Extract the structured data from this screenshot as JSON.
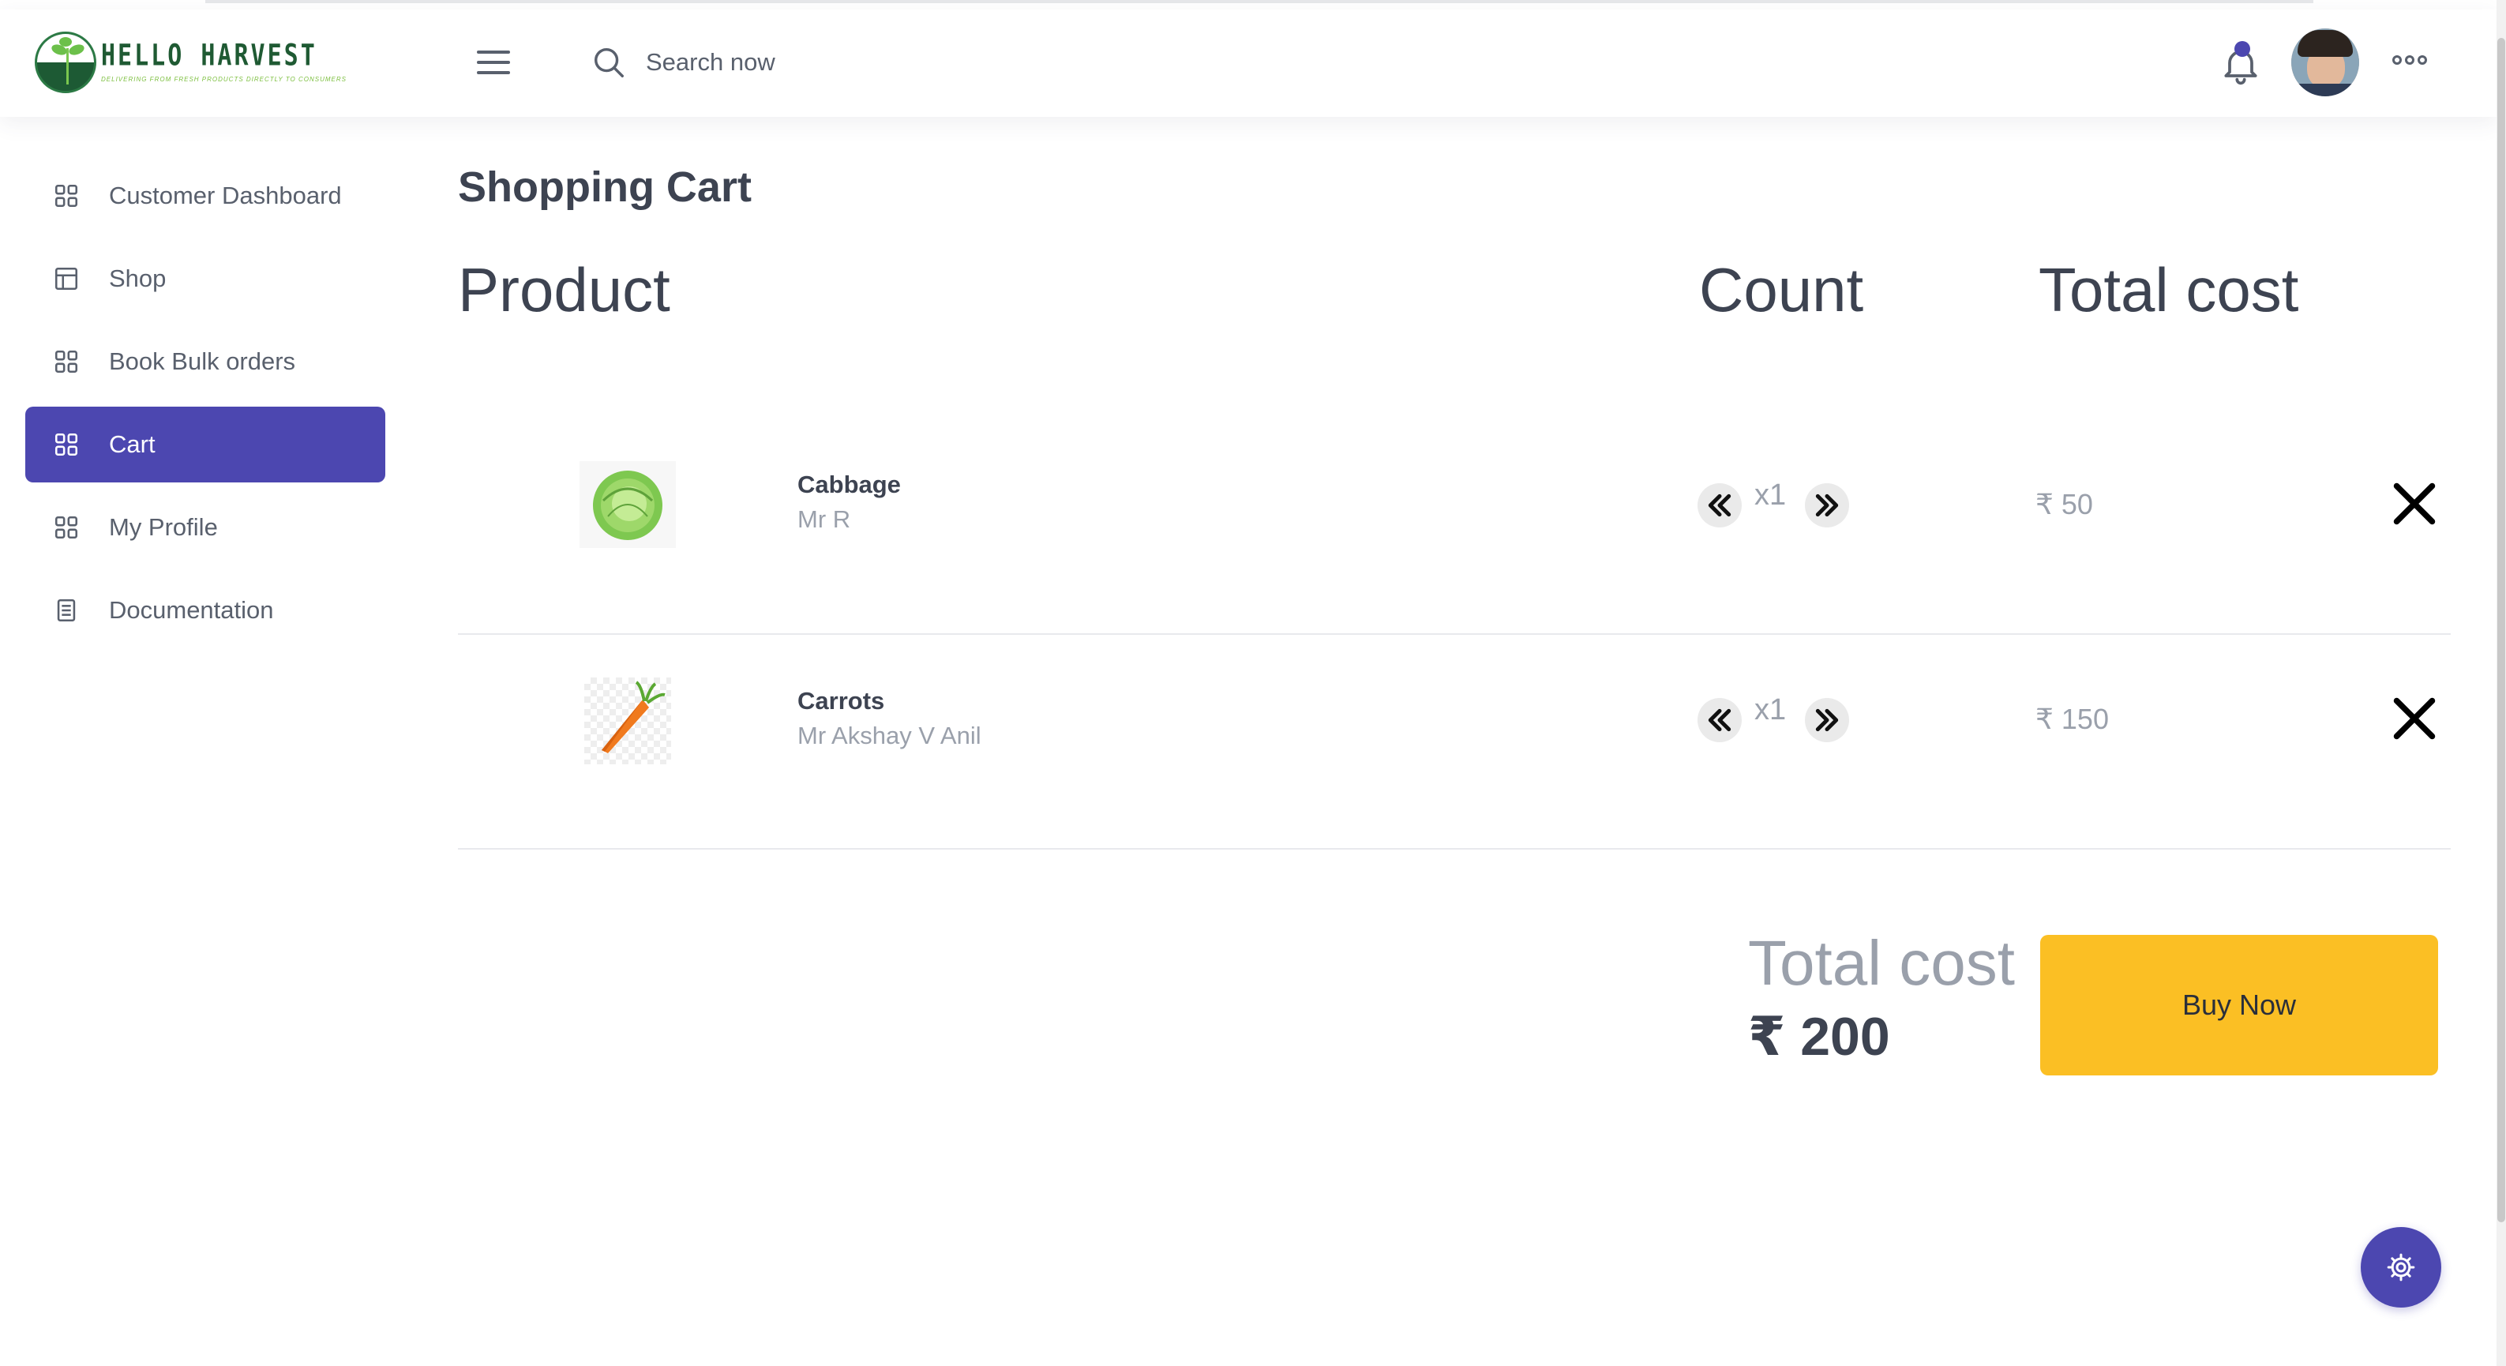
{
  "brand": {
    "name": "HELLO HARVEST",
    "tagline": "DELIVERING FROM FRESH PRODUCTS DIRECTLY TO CONSUMERS",
    "color": "#1f5a33"
  },
  "header": {
    "search_placeholder": "Search now",
    "icons": [
      "menu-icon",
      "search-icon",
      "bell-icon",
      "avatar",
      "more-icon"
    ]
  },
  "sidebar": {
    "items": [
      {
        "label": "Customer Dashboard",
        "icon": "grid-icon",
        "active": false
      },
      {
        "label": "Shop",
        "icon": "layout-icon",
        "active": false
      },
      {
        "label": "Book Bulk orders",
        "icon": "grid-icon",
        "active": false
      },
      {
        "label": "Cart",
        "icon": "grid-icon",
        "active": true
      },
      {
        "label": "My Profile",
        "icon": "grid-icon",
        "active": false
      },
      {
        "label": "Documentation",
        "icon": "document-icon",
        "active": false
      }
    ]
  },
  "cart": {
    "title": "Shopping Cart",
    "columns": {
      "product": "Product",
      "count": "Count",
      "total": "Total cost"
    },
    "items": [
      {
        "name": "Cabbage",
        "seller": "Mr R",
        "qty": "x1",
        "price": "₹ 50",
        "image": "cabbage"
      },
      {
        "name": "Carrots",
        "seller": "Mr Akshay V Anil",
        "qty": "x1",
        "price": "₹ 150",
        "image": "carrot"
      }
    ],
    "total_label": "Total cost",
    "total_value": "₹ 200",
    "buy_label": "Buy Now"
  },
  "colors": {
    "accent": "#4c47b0",
    "buy_button": "#fbbf24",
    "text": "#3d4351",
    "muted": "#9aa0ab"
  }
}
